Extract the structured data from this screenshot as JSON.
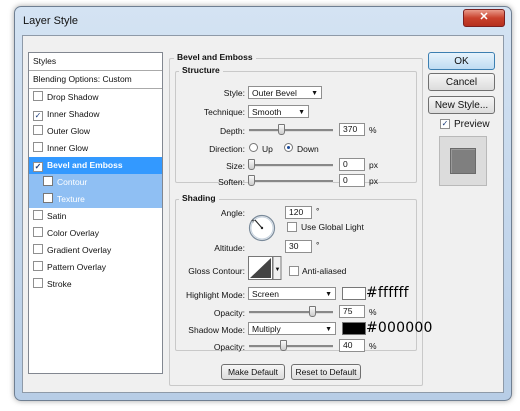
{
  "window": {
    "title": "Layer Style",
    "close_glyph": "✕"
  },
  "styles_list": {
    "header": "Styles",
    "blending_options": "Blending Options: Custom",
    "items": [
      {
        "label": "Drop Shadow",
        "checked": false
      },
      {
        "label": "Inner Shadow",
        "checked": true
      },
      {
        "label": "Outer Glow",
        "checked": false
      },
      {
        "label": "Inner Glow",
        "checked": false
      },
      {
        "label": "Bevel and Emboss",
        "checked": true,
        "selected": true
      },
      {
        "label": "Contour",
        "checked": false,
        "sub": true
      },
      {
        "label": "Texture",
        "checked": false,
        "sub": true
      },
      {
        "label": "Satin",
        "checked": false
      },
      {
        "label": "Color Overlay",
        "checked": false
      },
      {
        "label": "Gradient Overlay",
        "checked": false
      },
      {
        "label": "Pattern Overlay",
        "checked": false
      },
      {
        "label": "Stroke",
        "checked": false
      }
    ]
  },
  "bevel": {
    "title": "Bevel and Emboss",
    "structure": {
      "title": "Structure",
      "style_label": "Style:",
      "style_value": "Outer Bevel",
      "technique_label": "Technique:",
      "technique_value": "Smooth",
      "depth_label": "Depth:",
      "depth_value": "370",
      "depth_unit": "%",
      "direction_label": "Direction:",
      "direction_up": "Up",
      "direction_down": "Down",
      "size_label": "Size:",
      "size_value": "0",
      "size_unit": "px",
      "soften_label": "Soften:",
      "soften_value": "0",
      "soften_unit": "px"
    },
    "shading": {
      "title": "Shading",
      "angle_label": "Angle:",
      "angle_value": "120",
      "angle_unit": "°",
      "global_light_label": "Use Global Light",
      "altitude_label": "Altitude:",
      "altitude_value": "30",
      "altitude_unit": "°",
      "gloss_contour_label": "Gloss Contour:",
      "anti_aliased_label": "Anti-aliased",
      "highlight_mode_label": "Highlight Mode:",
      "highlight_mode_value": "Screen",
      "highlight_color": "#ffffff",
      "highlight_hex_label": "#ffffff",
      "highlight_opacity_label": "Opacity:",
      "highlight_opacity_value": "75",
      "highlight_opacity_unit": "%",
      "shadow_mode_label": "Shadow Mode:",
      "shadow_mode_value": "Multiply",
      "shadow_color": "#000000",
      "shadow_hex_label": "#000000",
      "shadow_opacity_label": "Opacity:",
      "shadow_opacity_value": "40",
      "shadow_opacity_unit": "%"
    },
    "make_default": "Make Default",
    "reset_default": "Reset to Default"
  },
  "right_panel": {
    "ok": "OK",
    "cancel": "Cancel",
    "new_style": "New Style...",
    "preview_label": "Preview",
    "preview_checked": true
  }
}
